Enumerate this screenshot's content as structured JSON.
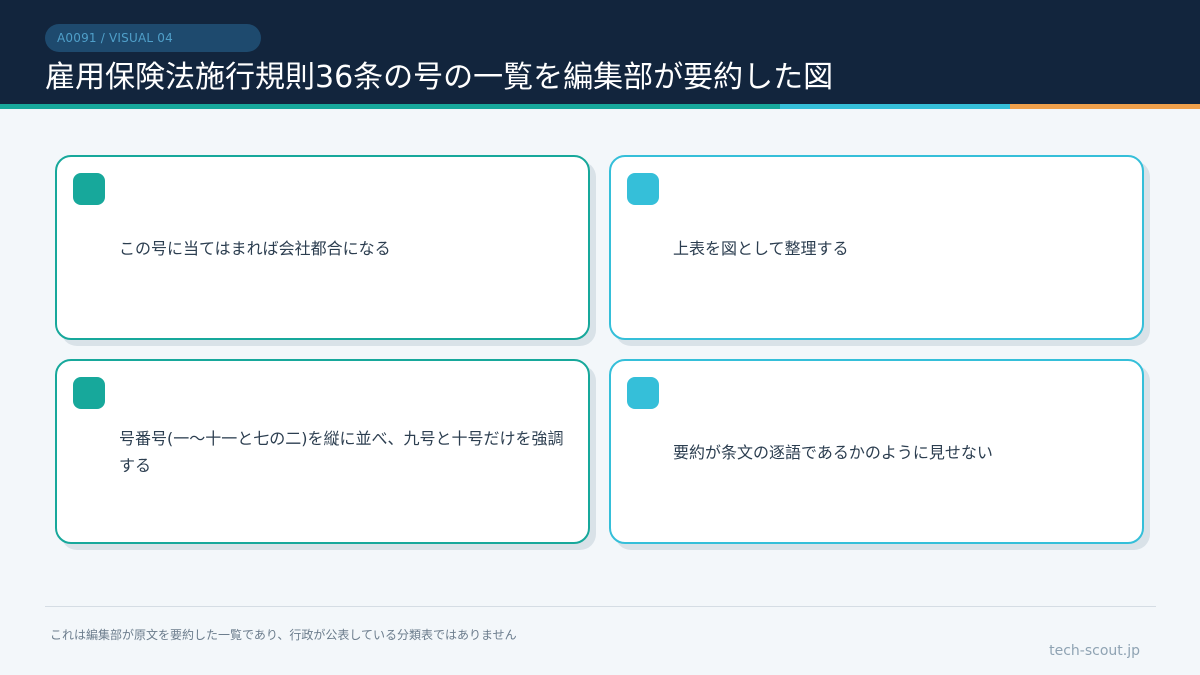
{
  "header": {
    "badge": "A0091 / VISUAL 04",
    "title": "雇用保険法施行規則36条の号の一覧を編集部が要約した図"
  },
  "colors": {
    "header_bg": "#12253d",
    "teal": "#17a89b",
    "cyan": "#35bfd9",
    "orange": "#f0a04b"
  },
  "cards": [
    {
      "text": "この号に当てはまれば会社都合になる",
      "accent": "teal"
    },
    {
      "text": "上表を図として整理する",
      "accent": "cyan"
    },
    {
      "text": "号番号(一〜十一と七の二)を縦に並べ、九号と十号だけを強調する",
      "accent": "teal"
    },
    {
      "text": "要約が条文の逐語であるかのように見せない",
      "accent": "cyan"
    }
  ],
  "footer": {
    "note": "これは編集部が原文を要約した一覧であり、行政が公表している分類表ではありません",
    "brand": "tech-scout.jp"
  }
}
